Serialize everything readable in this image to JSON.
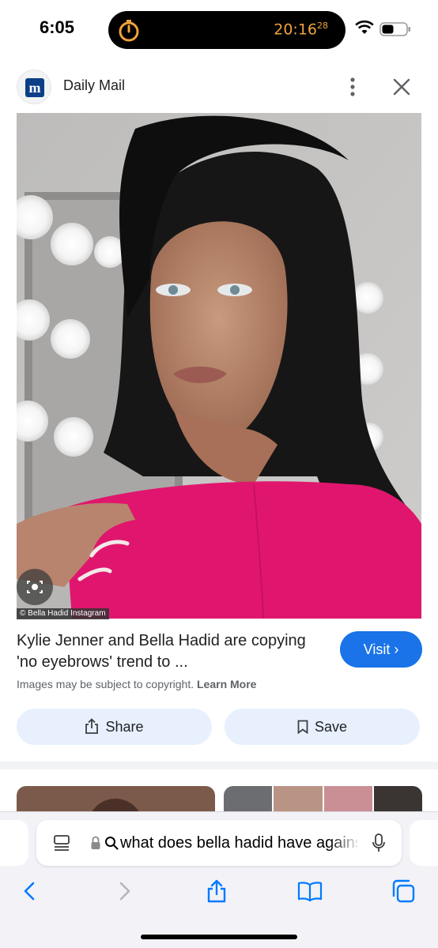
{
  "status_bar": {
    "time": "6:05",
    "island_timer": "20:16",
    "island_timer_fraction": "28",
    "icons": [
      "timer-icon",
      "wifi-icon",
      "battery-icon"
    ]
  },
  "source": {
    "logo_letter": "m",
    "name": "Daily Mail",
    "icons": [
      "more-vertical-icon",
      "close-icon"
    ]
  },
  "image": {
    "credit": "© Bella Hadid Instagram"
  },
  "result": {
    "title": "Kylie Jenner and Bella Hadid are copying 'no eyebrows' trend to ...",
    "visit_label": "Visit ›",
    "copyright_text": "Images may be subject to copyright.",
    "learn_more": "Learn More"
  },
  "actions": {
    "share_label": "Share",
    "save_label": "Save"
  },
  "address_bar": {
    "query": "what does bella hadid have against",
    "icons": [
      "tabs-icon",
      "lock-icon",
      "search-icon",
      "microphone-icon"
    ]
  },
  "toolbar": {
    "icons": [
      "back-icon",
      "forward-icon",
      "share-icon",
      "bookmarks-icon",
      "tabs-icon"
    ]
  },
  "colors": {
    "accent": "#1a73e8",
    "action_bg": "#e8f0fe",
    "island_text": "#f0a23a",
    "ios_blue": "#007aff"
  }
}
